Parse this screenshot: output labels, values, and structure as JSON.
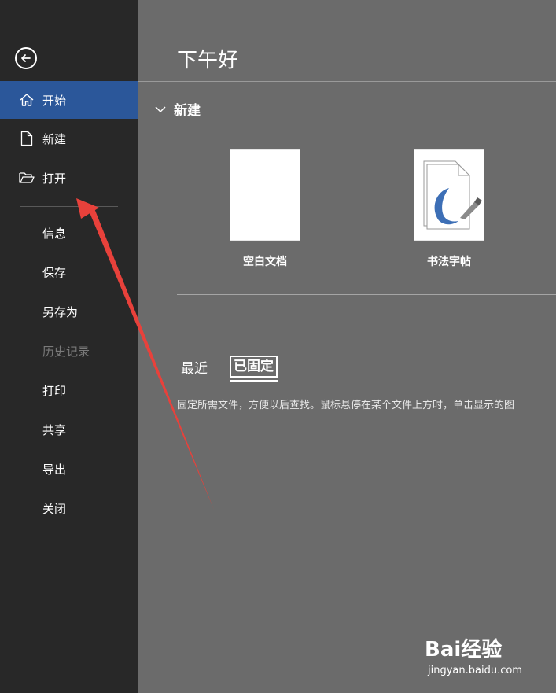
{
  "sidebar": {
    "back_icon": "back-arrow-icon",
    "items": [
      {
        "label": "开始",
        "icon": "home-icon",
        "active": true
      },
      {
        "label": "新建",
        "icon": "new-document-icon"
      },
      {
        "label": "打开",
        "icon": "open-folder-icon"
      },
      {
        "label": "信息"
      },
      {
        "label": "保存"
      },
      {
        "label": "另存为"
      },
      {
        "label": "历史记录",
        "disabled": true
      },
      {
        "label": "打印"
      },
      {
        "label": "共享"
      },
      {
        "label": "导出"
      },
      {
        "label": "关闭"
      }
    ]
  },
  "main": {
    "greeting": "下午好",
    "new_section": {
      "title": "新建",
      "toggle_icon": "chevron-down-icon"
    },
    "templates": [
      {
        "name": "空白文档"
      },
      {
        "name": "书法字帖"
      }
    ],
    "tabs": [
      {
        "label": "最近"
      },
      {
        "label": "已固定",
        "selected": true
      }
    ],
    "hint": "固定所需文件，方便以后查找。鼠标悬停在某个文件上方时，单击显示的图"
  },
  "watermark": {
    "brand": "Bai经验",
    "site": "jingyan.baidu.com"
  },
  "colors": {
    "sidebar_bg": "#282828",
    "active_bg": "#2b579a",
    "main_bg": "#6b6b6b",
    "arrow": "#e8413b"
  }
}
